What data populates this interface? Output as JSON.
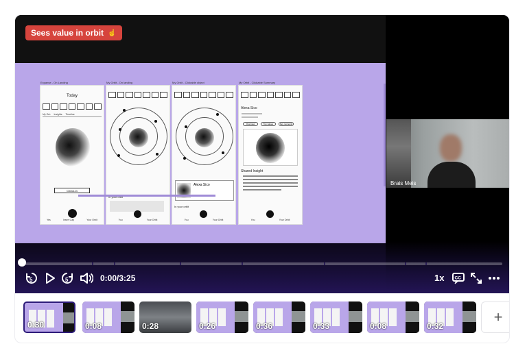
{
  "player": {
    "badge_label": "Sees value in orbit",
    "badge_icon": "pointer-hand-icon",
    "participant_name": "Brais Meis",
    "time_display": "0:00/3:25",
    "speed_label": "1x",
    "progress_fraction": 0.0,
    "accent_color": "#d6443d",
    "slide_bg_color": "#b9a6e9"
  },
  "slide": {
    "frames": [
      {
        "caption": "Expanse - On Landing",
        "title": "Today",
        "tabs": [
          "My Orb",
          "Insights",
          "Timeline"
        ],
        "button": "Check-in",
        "nav": [
          "Yes",
          "Insert Cap",
          "Your Orbit"
        ]
      },
      {
        "caption": "My Orbit - On landing",
        "section": "In your orbit",
        "nav": [
          "You",
          "Your Orbit"
        ]
      },
      {
        "caption": "My Orbit - Clickable object",
        "popup_title": "Alexa Sico",
        "section": "In your orbit",
        "nav": [
          "You",
          "Your Orbit"
        ]
      },
      {
        "caption": "My Orbit - Clickable Summary",
        "modal_title": "Alexa Sico",
        "pills": [
          "Overview",
          "Top values",
          "Key moments"
        ],
        "insight_title": "Shared Insight",
        "nav": [
          "You",
          "Your Orbit"
        ]
      }
    ]
  },
  "controls": {
    "rewind_icon": "rewind-5-icon",
    "play_icon": "play-icon",
    "forward_icon": "forward-5-icon",
    "volume_icon": "volume-icon",
    "captions_icon": "closed-captions-icon",
    "fullscreen_icon": "expand-icon",
    "more_icon": "more-horizontal-icon"
  },
  "clips": [
    {
      "duration": "0:30",
      "kind": "share",
      "active": true
    },
    {
      "duration": "0:08",
      "kind": "share",
      "active": false
    },
    {
      "duration": "0:28",
      "kind": "video",
      "active": false
    },
    {
      "duration": "0:26",
      "kind": "share",
      "active": false
    },
    {
      "duration": "0:36",
      "kind": "share",
      "active": false
    },
    {
      "duration": "0:33",
      "kind": "share",
      "active": false
    },
    {
      "duration": "0:08",
      "kind": "share",
      "active": false
    },
    {
      "duration": "0:32",
      "kind": "share",
      "active": false
    }
  ],
  "add_clip_label": "+"
}
